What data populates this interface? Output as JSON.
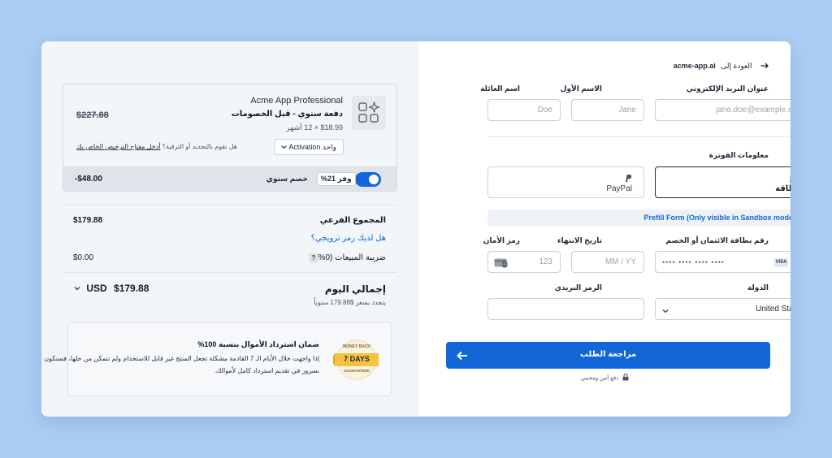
{
  "colors": {
    "page_bg": "#abcdf5",
    "accent": "#1266d8",
    "panel_bg": "#f3f6f9",
    "guarantee_badge": "#f5c341"
  },
  "left": {
    "product": {
      "name": "Acme App Professional",
      "billing": "دفعة سنوي - قبل الخصومات",
      "qty_price": "$18.99 × 12 أشهر",
      "original_price": "$227.88",
      "icon": "apps-sparkle-icon",
      "activation_select": "Activation واحد",
      "license_question": "هل تقوم بالتجديد أو الترقية؟ ",
      "license_link": "أدخل مفتاح الترخيص الخاص بك",
      "toggle_on": true,
      "save_badge": "وفر 21%",
      "annual_discount_label": "خصم سنوي",
      "discount_amount": "-$48.00"
    },
    "subtotal_label": "المجموع الفرعي",
    "subtotal_value": "$179.88",
    "promo_link": "هل لديك رمز ترويجي؟",
    "tax_label": "ضريبة المبيعات (0%)",
    "tax_help": "?",
    "tax_value": "$0.00",
    "total_label": "إجمالي اليوم",
    "total_value": "$179.88",
    "currency": "USD",
    "renew_note": "يتجدد بسعر $179.88 سنوياً",
    "guarantee": {
      "title": "ضمان استرداد الأموال بنسبة 100%",
      "body_line1": "إذا واجهت خلال الأيام الـ 7 القادمة مشكلة تجعل المنتج غير قابل للاستخدام ولم نتمكن من حلها، فسنكون",
      "body_line2": "بسرور في تقديم استرداد كامل لأموالك.",
      "badge_top": "MONEY BACK",
      "badge_main": "7 DAYS",
      "badge_bottom": "GUARANTEED"
    }
  },
  "right": {
    "back_text": "العودة إلى",
    "back_domain": "acme-app.ai",
    "email_label": "عنوان البريد الإلكتروني",
    "email_placeholder": "jane.doe@example.com",
    "first_name_label": "الاسم الأول",
    "first_name_placeholder": "Jane",
    "last_name_label": "اسم العائلة",
    "last_name_placeholder": "Doe",
    "billing_info_label": "معلومات الفوترة",
    "pay_card_label": "بطاقة",
    "pay_paypal_label": "PayPal",
    "prefill_text": "Prefill Form (Only visible in Sandbox mode)",
    "card_number_label": "رقم بطاقة الائتمان أو الخصم",
    "card_number_placeholder": "•••• •••• •••• ••••",
    "card_brand_visa": "VISA",
    "expiry_label": "تاريخ الانتهاء",
    "expiry_placeholder": "MM / YY",
    "cvc_label": "رمز الأمان",
    "cvc_placeholder": "123",
    "country_label": "الدولة",
    "country_value": "United States",
    "zip_label": "الرمز البريدي",
    "zip_placeholder": "",
    "review_button": "مراجعة الطلب",
    "secure_note": "دفع آمن ومحمي"
  }
}
